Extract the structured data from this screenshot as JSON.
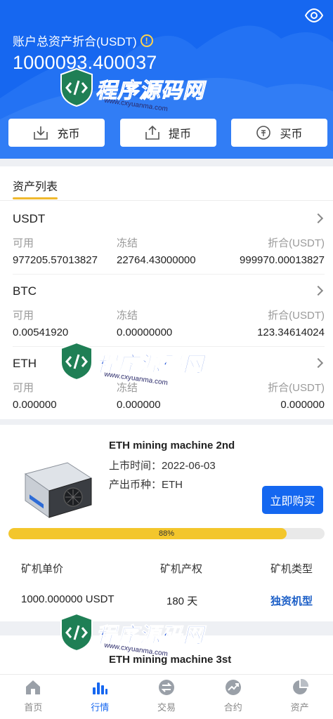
{
  "header": {
    "asset_label": "账户总资产折合(USDT)",
    "info_glyph": "!",
    "total_value": "1000093.400037",
    "actions": [
      {
        "label": "充币",
        "icon": "deposit-icon"
      },
      {
        "label": "提币",
        "icon": "withdraw-icon"
      },
      {
        "label": "买币",
        "icon": "buy-coin-icon"
      }
    ],
    "colors": {
      "primary": "#1667f0",
      "accent": "#f0b92e"
    }
  },
  "assets": {
    "tab_title": "资产列表",
    "coins": [
      {
        "name": "USDT",
        "available_label": "可用",
        "available": "977205.57013827",
        "frozen_label": "冻结",
        "frozen": "22764.43000000",
        "value_label": "折合(USDT)",
        "value": "999970.00013827"
      },
      {
        "name": "BTC",
        "available_label": "可用",
        "available": "0.00541920",
        "frozen_label": "冻结",
        "frozen": "0.00000000",
        "value_label": "折合(USDT)",
        "value": "123.34614024"
      },
      {
        "name": "ETH",
        "available_label": "可用",
        "available": "0.000000",
        "frozen_label": "冻结",
        "frozen": "0.000000",
        "value_label": "折合(USDT)",
        "value": "0.000000"
      }
    ]
  },
  "miner": {
    "title": "ETH mining machine 2nd",
    "listing_label": "上市时间：",
    "listing_date": "2022-06-03",
    "coin_label": "产出币种：",
    "coin": "ETH",
    "buy_label": "立即购买",
    "progress": 88,
    "progress_text": "88%",
    "spec_headers": [
      "矿机单价",
      "矿机产权",
      "矿机类型"
    ],
    "spec_values": [
      "1000.000000 USDT",
      "180 天",
      "独资机型"
    ]
  },
  "miner2": {
    "title": "ETH mining machine 3st"
  },
  "watermark": {
    "main": "程序源码网",
    "sub": "www.cxyuanma.com"
  },
  "tabbar": [
    {
      "label": "首页",
      "icon": "home-icon"
    },
    {
      "label": "行情",
      "icon": "market-chart-icon",
      "active": true
    },
    {
      "label": "交易",
      "icon": "trade-icon"
    },
    {
      "label": "合约",
      "icon": "contract-icon"
    },
    {
      "label": "资产",
      "icon": "assets-pie-icon"
    }
  ]
}
